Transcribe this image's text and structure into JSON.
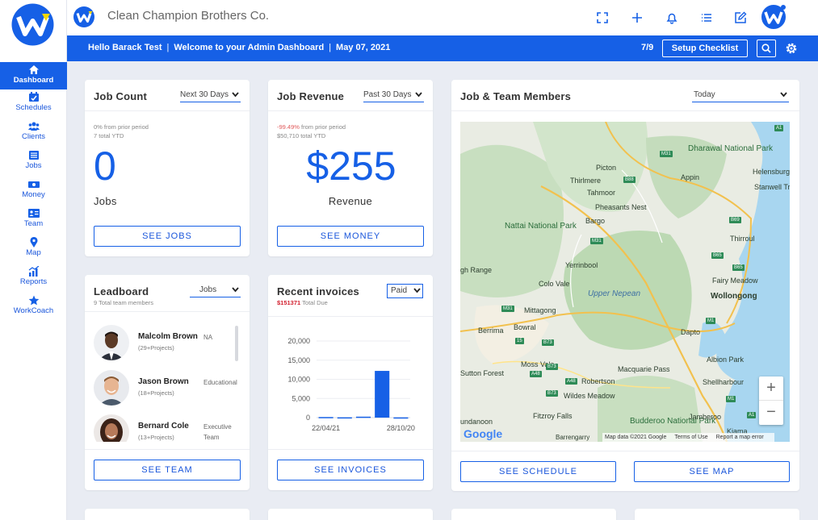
{
  "app": {
    "company": "Clean Champion Brothers Co.",
    "brand_color": "#1660e6",
    "icons": [
      "fullscreen-icon",
      "plus-icon",
      "bell-icon",
      "list-icon",
      "edit-icon"
    ]
  },
  "sidebar": {
    "items": [
      {
        "label": "Dashboard",
        "icon": "home-icon",
        "active": true
      },
      {
        "label": "Schedules",
        "icon": "calendar-icon"
      },
      {
        "label": "Clients",
        "icon": "users-icon"
      },
      {
        "label": "Jobs",
        "icon": "list-icon"
      },
      {
        "label": "Money",
        "icon": "money-icon"
      },
      {
        "label": "Team",
        "icon": "id-card-icon"
      },
      {
        "label": "Map",
        "icon": "map-pin-icon"
      },
      {
        "label": "Reports",
        "icon": "chart-icon"
      },
      {
        "label": "WorkCoach",
        "icon": "star-icon"
      }
    ]
  },
  "bluebar": {
    "greeting": "Hello Barack Test",
    "welcome": "Welcome to your Admin Dashboard",
    "date": "May 07, 2021",
    "progress": "7/9",
    "checklist_label": "Setup Checklist"
  },
  "job_count": {
    "title": "Job Count",
    "dropdown": "Next 30 Days",
    "change": "0% from prior period",
    "ytd": "7 total YTD",
    "value": "0",
    "label": "Jobs",
    "button": "SEE JOBS"
  },
  "job_revenue": {
    "title": "Job Revenue",
    "dropdown": "Past 30 Days",
    "change_value": "-99.49%",
    "change_text": " from prior period",
    "ytd": "$50,710 total YTD",
    "value": "$255",
    "label": "Revenue",
    "button": "SEE MONEY"
  },
  "leaderboard": {
    "title": "Leadboard",
    "subtitle": "9 Total team members",
    "dropdown": "Jobs",
    "members": [
      {
        "name": "Malcolm Brown",
        "projects": "(29+Projects)",
        "role": "NA"
      },
      {
        "name": "Jason Brown",
        "projects": "(18+Projects)",
        "role": "Educational"
      },
      {
        "name": "Bernard Cole",
        "projects": "(13+Projects)",
        "role": "Executive Team"
      }
    ],
    "button": "SEE TEAM"
  },
  "invoices": {
    "title": "Recent invoices",
    "due_amount": "$151371",
    "due_text": " Total Due",
    "dropdown": "Paid",
    "button": "SEE INVOICES"
  },
  "chart_data": {
    "type": "bar",
    "title": "",
    "xlabel": "",
    "ylabel": "",
    "categories": [
      "22/04/21",
      "",
      "",
      "",
      "28/10/20"
    ],
    "x_tick_labels": [
      "22/04/21",
      "28/10/20"
    ],
    "values": [
      150,
      80,
      250,
      12200,
      60
    ],
    "ylim": [
      0,
      20000
    ],
    "y_ticks": [
      "0",
      "5,000",
      "10,000",
      "15,000",
      "20,000"
    ],
    "grid": true,
    "bar_color": "#1660e6"
  },
  "team_map": {
    "title": "Job & Team Members",
    "dropdown": "Today",
    "labels": {
      "dharawal": "Dharawal National Park",
      "nattai": "Nattai National Park",
      "upper_nepean": "Upper Nepean",
      "budderoo": "Budderoo National Park",
      "picton": "Picton",
      "thirlmere": "Thirlmere",
      "tahmoor": "Tahmoor",
      "pheasants": "Pheasants Nest",
      "appin": "Appin",
      "helensburgh": "Helensburgh",
      "stanwell": "Stanwell Tr",
      "bargo": "Bargo",
      "thirroul": "Thirroul",
      "yerrinbool": "Yerrinbool",
      "high_range": "gh Range",
      "colo_vale": "Colo Vale",
      "fairy_meadow": "Fairy Meadow",
      "wollongong": "Wollongong",
      "mittagong": "Mittagong",
      "berrima": "Berrima",
      "bowral": "Bowral",
      "dapto": "Dapto",
      "moss_vale": "Moss Vale",
      "sutton_forest": "Sutton Forest",
      "robertson": "Robertson",
      "macquarie_pass": "Macquarie Pass",
      "shellharbour": "Shellharbour",
      "wildes_meadow": "Wildes Meadow",
      "fitzroy_falls": "Fitzroy Falls",
      "jamberoo": "Jamberoo",
      "kiama": "Kiama",
      "bundanoon": "undanoon",
      "barrengarry": "Barrengarry",
      "albion_park": "Albion Park"
    },
    "roads": [
      "A1",
      "M31",
      "B88",
      "B69",
      "M31",
      "B65",
      "B65",
      "M1",
      "M31",
      "15",
      "B73",
      "B73",
      "A48",
      "A48",
      "B73",
      "M1",
      "A1"
    ],
    "attribution": [
      "Map data ©2021 Google",
      "Terms of Use",
      "Report a map error"
    ],
    "google": "Google",
    "zoom_in": "+",
    "zoom_out": "−",
    "buttons": {
      "schedule": "SEE SCHEDULE",
      "map": "SEE MAP"
    }
  }
}
